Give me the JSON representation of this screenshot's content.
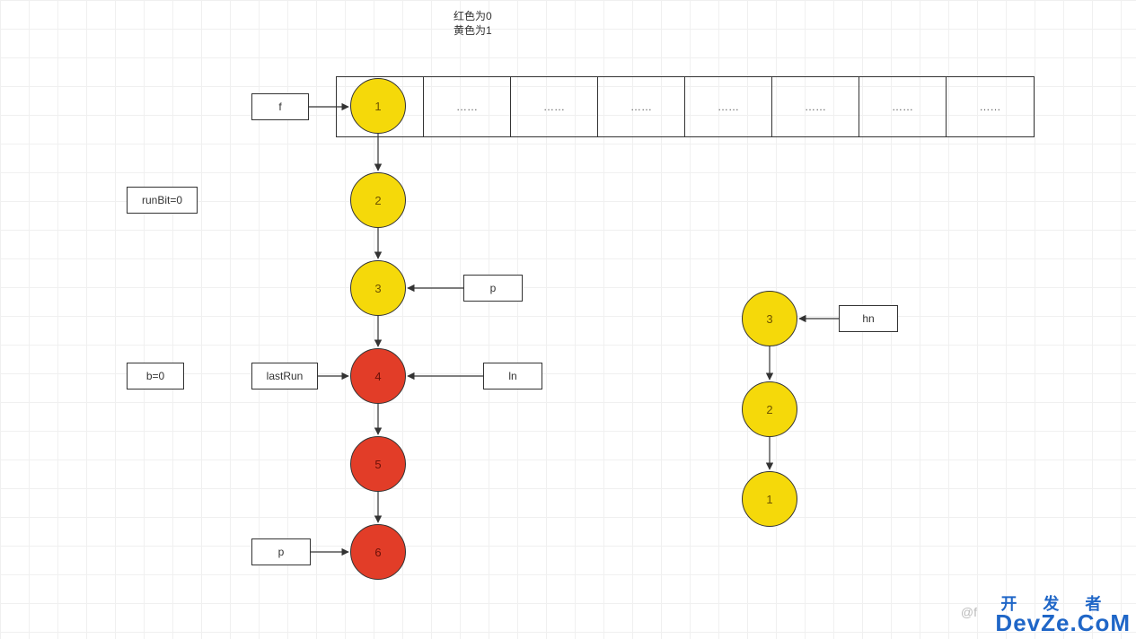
{
  "title_line1": "红色为0",
  "title_line2": "黄色为1",
  "colors": {
    "yellow": "#f5d90a",
    "red": "#e23d28"
  },
  "legend": {
    "red_means": 0,
    "yellow_means": 1
  },
  "array": {
    "cells": [
      "",
      "……",
      "……",
      "……",
      "……",
      "……",
      "……",
      "……"
    ]
  },
  "labels": {
    "f": "f",
    "runBit": "runBit=0",
    "b": "b=0",
    "lastRun": "lastRun",
    "p_top": "p",
    "ln": "ln",
    "p_bottom": "p",
    "hn": "hn"
  },
  "leftChain": [
    {
      "id": "1",
      "text": "1",
      "color": "yellow"
    },
    {
      "id": "2",
      "text": "2",
      "color": "yellow"
    },
    {
      "id": "3",
      "text": "3",
      "color": "yellow"
    },
    {
      "id": "4",
      "text": "4",
      "color": "red"
    },
    {
      "id": "5",
      "text": "5",
      "color": "red"
    },
    {
      "id": "6",
      "text": "6",
      "color": "red"
    }
  ],
  "rightChain": [
    {
      "id": "r3",
      "text": "3",
      "color": "yellow"
    },
    {
      "id": "r2",
      "text": "2",
      "color": "yellow"
    },
    {
      "id": "r1",
      "text": "1",
      "color": "yellow"
    }
  ],
  "watermark1": "@f",
  "watermark2_top": "开 发 者",
  "watermark2_bottom": "DevZe.CoM"
}
